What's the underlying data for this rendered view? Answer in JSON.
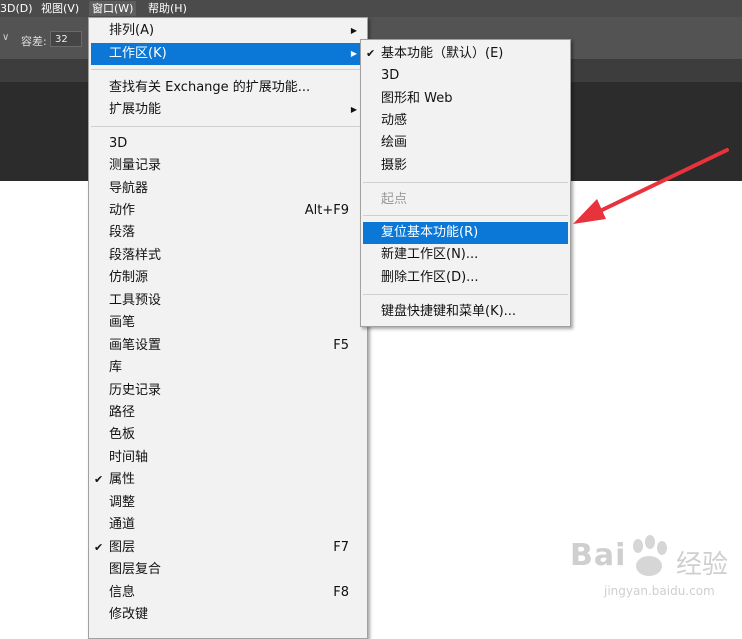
{
  "menubar": {
    "items": [
      {
        "label": "3D(D)"
      },
      {
        "label": "视图(V)"
      },
      {
        "label": "窗口(W)"
      },
      {
        "label": "帮助(H)"
      }
    ]
  },
  "options": {
    "tolerance_label": "容差:",
    "tolerance_value": "32"
  },
  "window_menu": {
    "items": [
      {
        "label": "排列(A)"
      },
      {
        "label": "工作区(K)"
      },
      {
        "label": "查找有关 Exchange 的扩展功能..."
      },
      {
        "label": "扩展功能"
      },
      {
        "label": "3D"
      },
      {
        "label": "测量记录"
      },
      {
        "label": "导航器"
      },
      {
        "label": "动作",
        "shortcut": "Alt+F9"
      },
      {
        "label": "段落"
      },
      {
        "label": "段落样式"
      },
      {
        "label": "仿制源"
      },
      {
        "label": "工具预设"
      },
      {
        "label": "画笔"
      },
      {
        "label": "画笔设置",
        "shortcut": "F5"
      },
      {
        "label": "库"
      },
      {
        "label": "历史记录"
      },
      {
        "label": "路径"
      },
      {
        "label": "色板"
      },
      {
        "label": "时间轴"
      },
      {
        "label": "属性"
      },
      {
        "label": "调整"
      },
      {
        "label": "通道"
      },
      {
        "label": "图层",
        "shortcut": "F7"
      },
      {
        "label": "图层复合"
      },
      {
        "label": "信息",
        "shortcut": "F8"
      },
      {
        "label": "修改键"
      }
    ]
  },
  "workspace_submenu": {
    "items": [
      {
        "label": "基本功能（默认）(E)"
      },
      {
        "label": "3D"
      },
      {
        "label": "图形和 Web"
      },
      {
        "label": "动感"
      },
      {
        "label": "绘画"
      },
      {
        "label": "摄影"
      },
      {
        "label": "起点"
      },
      {
        "label": "复位基本功能(R)"
      },
      {
        "label": "新建工作区(N)..."
      },
      {
        "label": "删除工作区(D)..."
      },
      {
        "label": "键盘快捷键和菜单(K)..."
      }
    ]
  },
  "icons": {
    "check": "checkmark-icon",
    "submenu": "submenu-arrow-icon",
    "annotation": "red-arrow-annotation"
  },
  "colors": {
    "highlight": "#0b78d7",
    "menu_bg": "#f2f2f2",
    "annotation": "#e8323c"
  },
  "watermark": {
    "brand": "Bai",
    "brand_cn": "经验",
    "url": "jingyan.baidu.com"
  }
}
